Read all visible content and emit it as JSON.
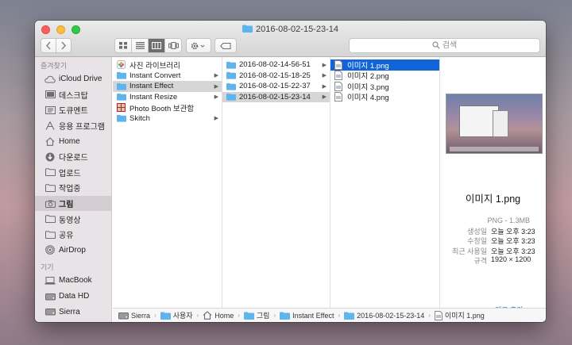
{
  "window": {
    "title": "2016-08-02-15-23-14"
  },
  "toolbar": {
    "search_placeholder": "검색"
  },
  "sidebar": {
    "favorites_header": "즐겨찾기",
    "favorites": [
      {
        "label": "iCloud Drive",
        "icon": "cloud-icon"
      },
      {
        "label": "데스크탑",
        "icon": "desktop-icon"
      },
      {
        "label": "도큐멘트",
        "icon": "documents-icon"
      },
      {
        "label": "응용 프로그램",
        "icon": "applications-icon"
      },
      {
        "label": "Home",
        "icon": "home-icon"
      },
      {
        "label": "다운로드",
        "icon": "download-icon"
      },
      {
        "label": "업로드",
        "icon": "folder-icon"
      },
      {
        "label": "작업중",
        "icon": "folder-icon"
      },
      {
        "label": "그림",
        "icon": "camera-icon",
        "selected": true
      },
      {
        "label": "동영상",
        "icon": "folder-icon"
      },
      {
        "label": "공유",
        "icon": "folder-icon"
      },
      {
        "label": "AirDrop",
        "icon": "airdrop-icon"
      }
    ],
    "devices_header": "기기",
    "devices": [
      {
        "label": "MacBook",
        "icon": "laptop-icon"
      },
      {
        "label": "Data HD",
        "icon": "disk-icon"
      },
      {
        "label": "Sierra",
        "icon": "disk-icon"
      }
    ]
  },
  "columns": {
    "col1": [
      {
        "label": "사진 라이브러리",
        "icon": "photos-library-icon",
        "chevron": false
      },
      {
        "label": "Instant Convert",
        "icon": "folder-icon",
        "chevron": true
      },
      {
        "label": "Instant Effect",
        "icon": "folder-icon",
        "chevron": true,
        "selected": true
      },
      {
        "label": "Instant Resize",
        "icon": "folder-icon",
        "chevron": true
      },
      {
        "label": "Photo Booth 보관함",
        "icon": "photo-booth-icon",
        "chevron": false
      },
      {
        "label": "Skitch",
        "icon": "folder-icon",
        "chevron": true
      }
    ],
    "col2": [
      {
        "label": "2016-08-02-14-56-51",
        "chevron": true
      },
      {
        "label": "2016-08-02-15-18-25",
        "chevron": true
      },
      {
        "label": "2016-08-02-15-22-37",
        "chevron": true
      },
      {
        "label": "2016-08-02-15-23-14",
        "chevron": true,
        "selected": true
      }
    ],
    "col3": [
      {
        "label": "이미지 1.png",
        "selected": true
      },
      {
        "label": "이미지 2.png"
      },
      {
        "label": "이미지 3.png"
      },
      {
        "label": "이미지 4.png"
      }
    ]
  },
  "preview": {
    "name": "이미지 1.png",
    "kind": "PNG - 1.3MB",
    "meta": [
      {
        "key": "생성일",
        "value": "오늘 오후 3:23"
      },
      {
        "key": "수정일",
        "value": "오늘 오후 3:23"
      },
      {
        "key": "최근 사용일",
        "value": "오늘 오후 3:23"
      },
      {
        "key": "규격",
        "value": "1920 × 1200"
      }
    ],
    "tags_link": "태그 추가..."
  },
  "pathbar": [
    {
      "label": "Sierra",
      "icon": "disk-icon"
    },
    {
      "label": "사용자",
      "icon": "folder-icon"
    },
    {
      "label": "Home",
      "icon": "home-icon"
    },
    {
      "label": "그림",
      "icon": "folder-icon"
    },
    {
      "label": "Instant Effect",
      "icon": "folder-icon"
    },
    {
      "label": "2016-08-02-15-23-14",
      "icon": "folder-icon"
    },
    {
      "label": "이미지 1.png",
      "icon": "image-file-icon"
    }
  ],
  "colors": {
    "accent": "#1165d8",
    "folder": "#5fb4ee",
    "selection_grey": "#d6d6d6",
    "sidebar_selected": "#d3cdd1"
  }
}
